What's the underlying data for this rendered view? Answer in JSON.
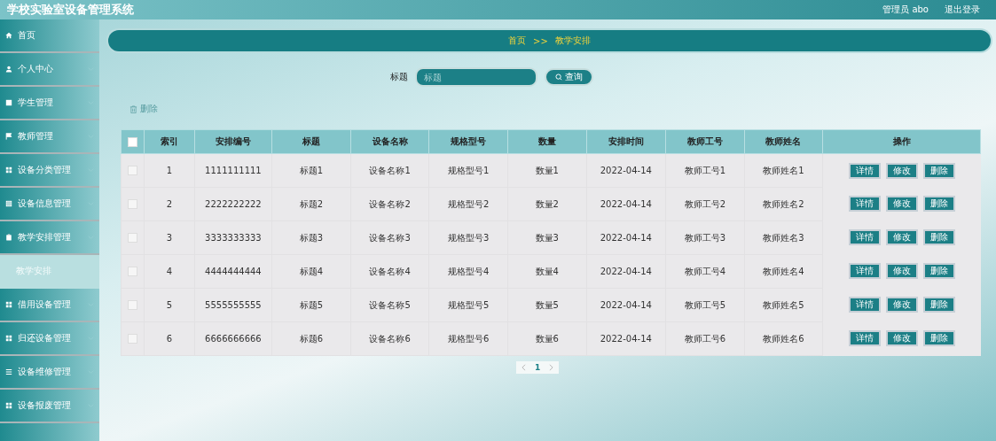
{
  "header": {
    "title": "学校实验室设备管理系统",
    "user": "管理员 abo",
    "logout": "退出登录"
  },
  "sidebar": {
    "items": [
      {
        "label": "首页"
      },
      {
        "label": "个人中心"
      },
      {
        "label": "学生管理"
      },
      {
        "label": "教师管理"
      },
      {
        "label": "设备分类管理"
      },
      {
        "label": "设备信息管理"
      },
      {
        "label": "教学安排管理",
        "children": [
          {
            "label": "教学安排",
            "selected": true
          }
        ]
      },
      {
        "label": "借用设备管理"
      },
      {
        "label": "归还设备管理"
      },
      {
        "label": "设备维修管理"
      },
      {
        "label": "设备报废管理"
      }
    ]
  },
  "breadcrumb": {
    "home": "首页",
    "separator": ">>",
    "current": "教学安排"
  },
  "search": {
    "label": "标题",
    "placeholder": "标题",
    "button": "查询"
  },
  "delete_button": "删除",
  "table": {
    "header_checked": false,
    "columns": [
      "索引",
      "安排编号",
      "标题",
      "设备名称",
      "规格型号",
      "数量",
      "安排时间",
      "教师工号",
      "教师姓名",
      "操作"
    ],
    "rows": [
      {
        "checked": false,
        "cells": [
          "1",
          "1111111111",
          "标题1",
          "设备名称1",
          "规格型号1",
          "数量1",
          "2022-04-14",
          "教师工号1",
          "教师姓名1"
        ],
        "actions": [
          "详情",
          "修改",
          "删除"
        ]
      },
      {
        "checked": false,
        "cells": [
          "2",
          "2222222222",
          "标题2",
          "设备名称2",
          "规格型号2",
          "数量2",
          "2022-04-14",
          "教师工号2",
          "教师姓名2"
        ],
        "actions": [
          "详情",
          "修改",
          "删除"
        ]
      },
      {
        "checked": false,
        "cells": [
          "3",
          "3333333333",
          "标题3",
          "设备名称3",
          "规格型号3",
          "数量3",
          "2022-04-14",
          "教师工号3",
          "教师姓名3"
        ],
        "actions": [
          "详情",
          "修改",
          "删除"
        ]
      },
      {
        "checked": false,
        "cells": [
          "4",
          "4444444444",
          "标题4",
          "设备名称4",
          "规格型号4",
          "数量4",
          "2022-04-14",
          "教师工号4",
          "教师姓名4"
        ],
        "actions": [
          "详情",
          "修改",
          "删除"
        ]
      },
      {
        "checked": false,
        "cells": [
          "5",
          "5555555555",
          "标题5",
          "设备名称5",
          "规格型号5",
          "数量5",
          "2022-04-14",
          "教师工号5",
          "教师姓名5"
        ],
        "actions": [
          "详情",
          "修改",
          "删除"
        ]
      },
      {
        "checked": false,
        "cells": [
          "6",
          "6666666666",
          "标题6",
          "设备名称6",
          "规格型号6",
          "数量6",
          "2022-04-14",
          "教师工号6",
          "教师姓名6"
        ],
        "actions": [
          "详情",
          "修改",
          "删除"
        ]
      }
    ]
  },
  "pagination": {
    "pages": [
      {
        "label": "1",
        "selected": true
      }
    ]
  }
}
